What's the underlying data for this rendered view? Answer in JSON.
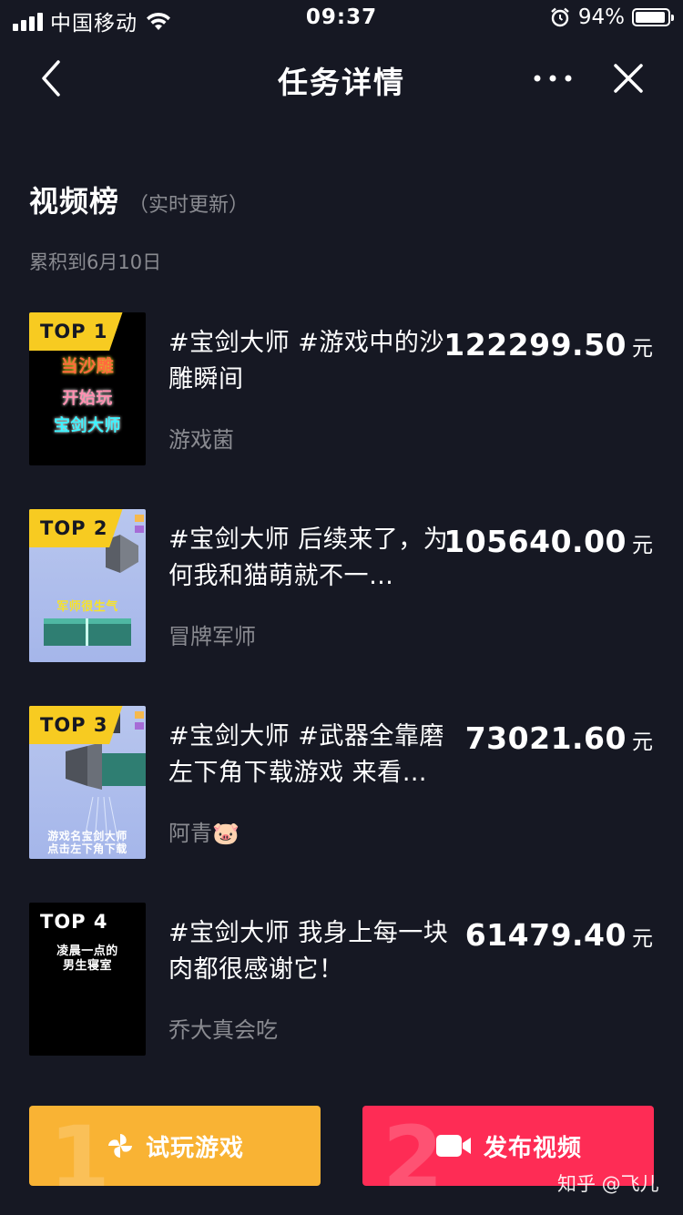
{
  "status_bar": {
    "carrier": "中国移动",
    "time": "09:37",
    "battery_percent": "94%",
    "battery_level": 0.94
  },
  "nav": {
    "title": "任务详情"
  },
  "section": {
    "title": "视频榜",
    "subtitle": "（实时更新）",
    "date_note": "累积到6月10日"
  },
  "items": [
    {
      "rank": "TOP 1",
      "title": "#宝剑大师 #游戏中的沙雕瞬间",
      "author": "游戏菌",
      "amount": "122299.50",
      "unit": "元",
      "thumb_lines": [
        "当沙雕",
        "开始玩",
        "宝剑大师"
      ]
    },
    {
      "rank": "TOP 2",
      "title": "#宝剑大师 后续来了，为何我和猫萌就不一…",
      "author": "冒牌军师",
      "amount": "105640.00",
      "unit": "元",
      "thumb_lines": [
        "军师很生气"
      ]
    },
    {
      "rank": "TOP 3",
      "title": "#宝剑大师 #武器全靠磨左下角下载游戏 来看…",
      "author": "阿青🐷",
      "amount": "73021.60",
      "unit": "元",
      "thumb_lines": [
        "游戏名宝剑大师",
        "点击左下角下载"
      ]
    },
    {
      "rank": "TOP 4",
      "title": "#宝剑大师 我身上每一块肉都很感谢它！",
      "author": "乔大真会吃",
      "amount": "61479.40",
      "unit": "元",
      "thumb_lines": [
        "凌晨一点的",
        "男生寝室"
      ]
    }
  ],
  "buttons": {
    "try": {
      "step": "1",
      "label": "试玩游戏"
    },
    "post": {
      "step": "2",
      "label": "发布视频"
    }
  },
  "watermark": "知乎 @飞儿",
  "colors": {
    "background": "#161823",
    "badge_yellow": "#f7cb21",
    "try_button": "#f9b334",
    "post_button": "#fe2c55",
    "secondary_text": "#8a8b91"
  }
}
